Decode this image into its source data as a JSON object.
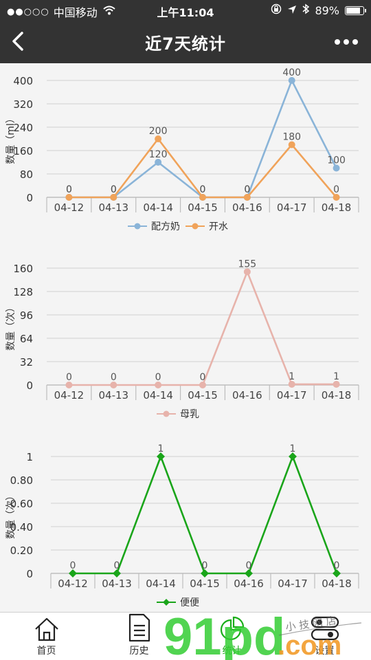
{
  "status_bar": {
    "carrier": "中国移动",
    "time": "上午11:04",
    "battery": "89%",
    "battery_level": 0.89
  },
  "nav": {
    "title": "近7天统计"
  },
  "chart_data": [
    {
      "type": "line",
      "categories": [
        "04-12",
        "04-13",
        "04-14",
        "04-15",
        "04-16",
        "04-17",
        "04-18"
      ],
      "ylabel": "数量（ml）",
      "yticks": [
        0,
        80,
        160,
        240,
        320,
        400
      ],
      "ylim": [
        0,
        400
      ],
      "marker": "circle",
      "grid": true,
      "legend_position": "bottom",
      "series": [
        {
          "name": "配方奶",
          "color": "#8ab4d8",
          "values": [
            0,
            0,
            120,
            0,
            0,
            400,
            100
          ],
          "labels": [
            "0",
            "0",
            "120",
            "0",
            "0",
            "400",
            "100"
          ]
        },
        {
          "name": "开水",
          "color": "#f0a35a",
          "values": [
            0,
            0,
            200,
            0,
            0,
            180,
            0
          ],
          "labels": [
            "0",
            "0",
            "200",
            "0",
            "0",
            "180",
            "0"
          ]
        }
      ]
    },
    {
      "type": "line",
      "categories": [
        "04-12",
        "04-13",
        "04-14",
        "04-15",
        "04-16",
        "04-17",
        "04-18"
      ],
      "ylabel": "数量（次）",
      "yticks": [
        0,
        32,
        64,
        96,
        128,
        160
      ],
      "ylim": [
        0,
        160
      ],
      "marker": "circle",
      "grid": true,
      "legend_position": "bottom",
      "series": [
        {
          "name": "母乳",
          "color": "#e7b3ab",
          "values": [
            0,
            0,
            0,
            0,
            155,
            1,
            1
          ],
          "labels": [
            "0",
            "0",
            "0",
            "0",
            "155",
            "1",
            "1"
          ]
        }
      ]
    },
    {
      "type": "line",
      "categories": [
        "04-12",
        "04-13",
        "04-14",
        "04-15",
        "04-16",
        "04-17",
        "04-18"
      ],
      "ylabel": "数量（次）",
      "yticks": [
        0,
        0.2,
        0.4,
        0.6,
        0.8,
        1
      ],
      "ytick_labels": [
        "0",
        "0.20",
        "0.40",
        "0.60",
        "0.80",
        "1"
      ],
      "ylim": [
        0,
        1
      ],
      "marker": "diamond",
      "grid": true,
      "legend_position": "bottom",
      "series": [
        {
          "name": "便便",
          "color": "#1aa51a",
          "values": [
            0,
            0,
            1,
            0,
            0,
            1,
            0
          ],
          "labels": [
            "0",
            "0",
            "1",
            "0",
            "0",
            "1",
            "0"
          ]
        }
      ]
    }
  ],
  "tabs": [
    {
      "label": "首页",
      "icon": "home-icon",
      "active": false
    },
    {
      "label": "历史",
      "icon": "document-icon",
      "active": false
    },
    {
      "label": "统计",
      "icon": "pie-chart-icon",
      "active": true
    },
    {
      "label": "设置",
      "icon": "toggle-icon",
      "active": false
    }
  ],
  "watermark": {
    "text_big": "91pd",
    "text_com": ".com",
    "text_script": "小 技 网 店"
  }
}
